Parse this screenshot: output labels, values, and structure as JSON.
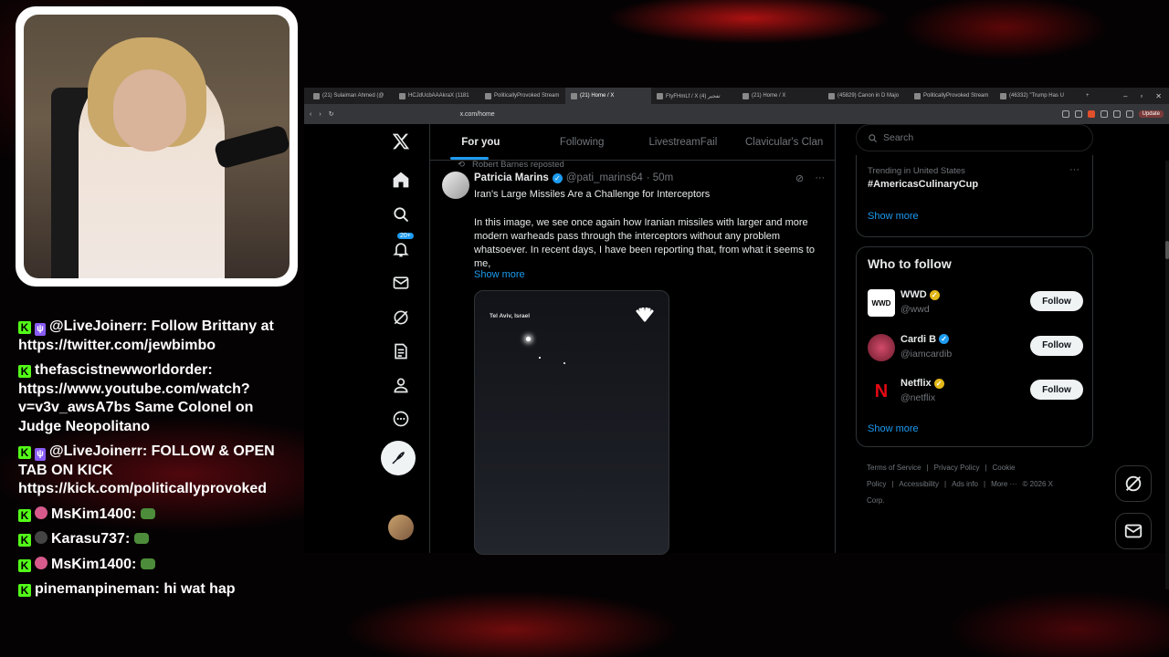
{
  "chat": {
    "messages": [
      {
        "user": "@LiveJoinerr:",
        "text": " Follow Brittany at https://twitter.com/jewbimbo",
        "badges": [
          "kick",
          "mod"
        ]
      },
      {
        "user": "thefascistnewworldorder:",
        "text": " https://www.youtube.com/watch?v=v3v_awsA7bs Same Colonel on Judge Neopolitano",
        "badges": [
          "kick"
        ]
      },
      {
        "user": "@LiveJoinerr:",
        "text": " FOLLOW & OPEN TAB ON KICK https://kick.com/politicallyprovoked",
        "badges": [
          "kick",
          "mod"
        ]
      },
      {
        "user": "MsKim1400:",
        "text": " ",
        "badges": [
          "kick",
          "avatar"
        ],
        "emote": true
      },
      {
        "user": "Karasu737:",
        "text": " ",
        "badges": [
          "kick",
          "avatar-dark"
        ],
        "emote": true
      },
      {
        "user": "MsKim1400:",
        "text": " ",
        "badges": [
          "kick",
          "avatar"
        ],
        "emote": true
      },
      {
        "user": "pinemanpineman:",
        "text": " hi wat hap",
        "badges": [
          "kick"
        ]
      }
    ]
  },
  "browser": {
    "tabs": [
      {
        "label": "(21) Sulaiman Ahmed (@",
        "active": false
      },
      {
        "label": "HCJdUcbAAAkraX (1181",
        "active": false
      },
      {
        "label": "PoliticallyProvoked Stream",
        "active": false
      },
      {
        "label": "(21) Home / X",
        "active": true
      },
      {
        "label": "FtyFHmLf / X تفجير (4)",
        "active": false
      },
      {
        "label": "(21) Home / X",
        "active": false
      },
      {
        "label": "(45829) Canon in D Majo",
        "active": false
      },
      {
        "label": "PoliticallyProvoked Stream",
        "active": false
      },
      {
        "label": "(46332) \"Trump Has U",
        "active": false
      }
    ],
    "new_tab": "+",
    "url": "x.com/home",
    "update_label": "Update"
  },
  "x": {
    "notif_badge": "20+",
    "feed_tabs": [
      "For you",
      "Following",
      "LivestreamFail",
      "Clavicular's Clan"
    ],
    "post": {
      "repost_by": "Robert Barnes reposted",
      "name": "Patricia Marins",
      "handle": "@pati_marins64",
      "time": "· 50m",
      "title": "Iran's Large Missiles Are a Challenge for Interceptors",
      "body": "In this image, we see once again how Iranian missiles with larger and more modern warheads pass through the interceptors without any problem whatsoever. In recent days, I have been reporting that, from what it seems to me,",
      "show_more": "Show more",
      "media_location": "Tel Aviv, Israel"
    },
    "search_placeholder": "Search",
    "trend": {
      "meta": "Trending in United States",
      "name": "#AmericasCulinaryCup",
      "show_more": "Show more"
    },
    "who_to_follow": {
      "title": "Who to follow",
      "accounts": [
        {
          "name": "WWD",
          "handle": "@wwd",
          "logo": "WWD",
          "verified": "gold"
        },
        {
          "name": "Cardi B",
          "handle": "@iamcardib",
          "logo": "",
          "verified": "blue"
        },
        {
          "name": "Netflix",
          "handle": "@netflix",
          "logo": "N",
          "verified": "gold"
        }
      ],
      "follow_label": "Follow",
      "show_more": "Show more"
    },
    "footer": [
      "Terms of Service",
      "|",
      "Privacy Policy",
      "|",
      "Cookie Policy",
      "|",
      "Accessibility",
      "|",
      "Ads info",
      "|",
      "More ···",
      "© 2026 X Corp."
    ]
  },
  "colors": {
    "accent": "#1d9bf0",
    "kick_green": "#53fc18",
    "gold_check": "#e2b719"
  }
}
